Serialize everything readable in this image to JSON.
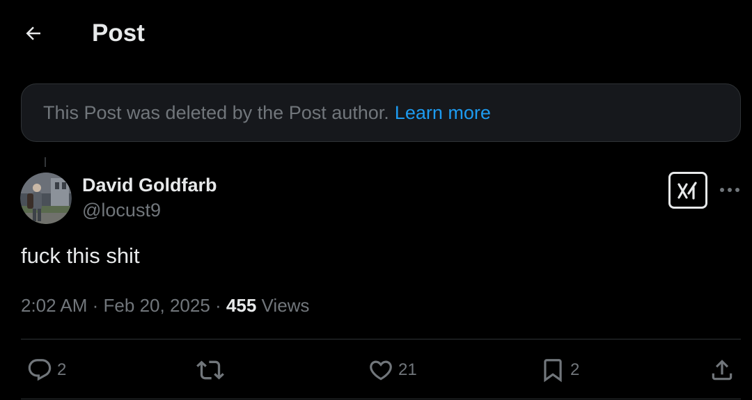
{
  "header": {
    "title": "Post",
    "back_icon": "arrow-left-icon"
  },
  "notice": {
    "text": "This Post was deleted by the Post author.",
    "link_label": "Learn more",
    "link_color": "#1d9bf0"
  },
  "author": {
    "name": "David Goldfarb",
    "handle": "@locust9"
  },
  "post": {
    "text": "fuck this shit",
    "time": "2:02 AM",
    "date": "Feb 20, 2025",
    "separator": "·",
    "views_count": "455",
    "views_label": "Views"
  },
  "actions": {
    "replies": "2",
    "reposts": "",
    "likes": "21",
    "bookmarks": "2"
  },
  "colors": {
    "background": "#000000",
    "text_primary": "#e7e9ea",
    "text_secondary": "#71767b",
    "notice_bg": "#16181c",
    "border": "#2f3336"
  }
}
